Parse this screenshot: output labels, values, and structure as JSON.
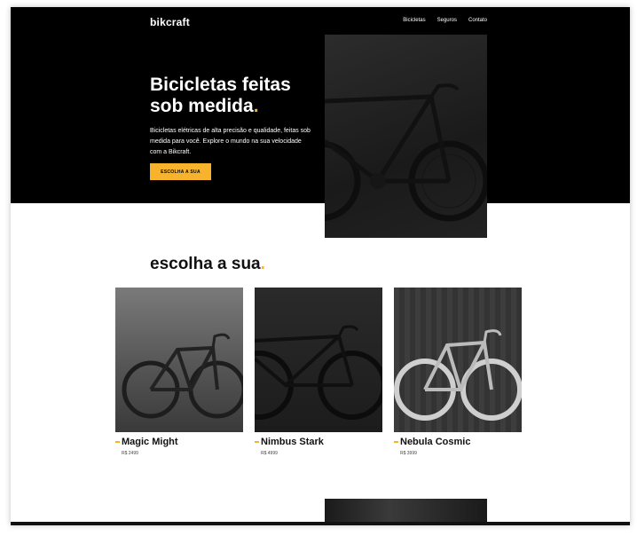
{
  "header": {
    "logo": "bikcraft",
    "nav": [
      "Bicicletas",
      "Seguros",
      "Contato"
    ]
  },
  "hero": {
    "title": "Bicicletas feitas sob medida",
    "title_dot": ".",
    "text": "Bicicletas elétricas de alta precisão e qualidade, feitas sob medida para você. Explore o mundo na sua velocidade com a Bikcraft.",
    "cta": "ESCOLHA A SUA"
  },
  "products": {
    "title": "escolha a sua",
    "title_dot": ".",
    "items": [
      {
        "name": "Magic Might",
        "price": "R$ 2499"
      },
      {
        "name": "Nimbus Stark",
        "price": "R$ 4999"
      },
      {
        "name": "Nebula Cosmic",
        "price": "R$ 3999"
      }
    ]
  },
  "colors": {
    "accent": "#f7b32b",
    "hero_bg": "#000000",
    "text_dark": "#111111"
  }
}
